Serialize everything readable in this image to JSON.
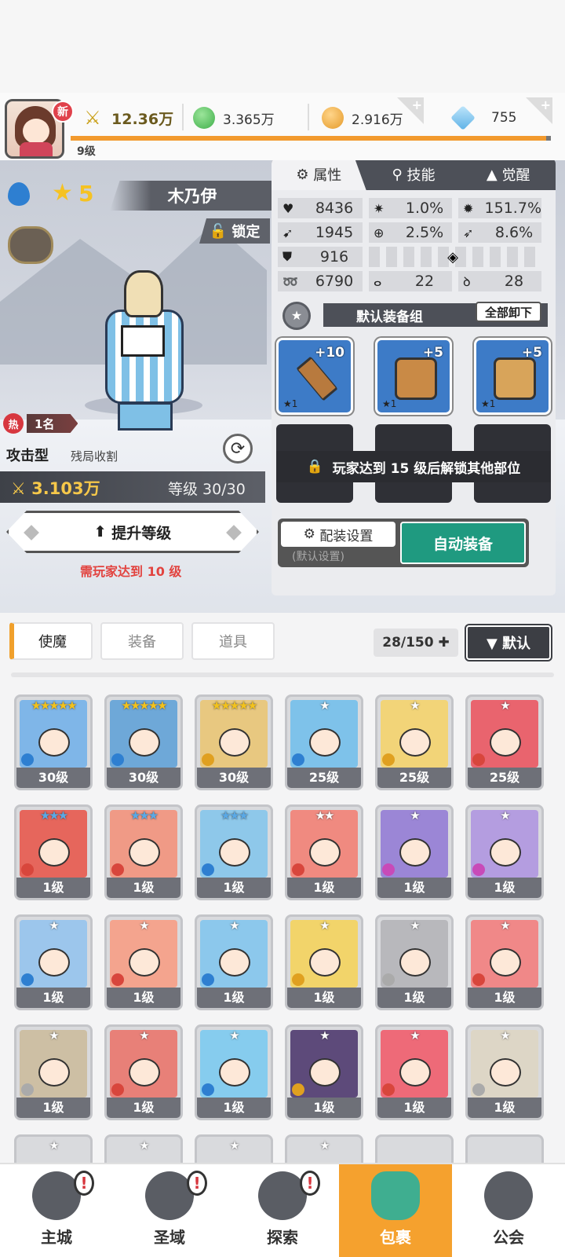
{
  "header": {
    "new_badge": "新",
    "power": "12.36万",
    "green_gem": "3.365万",
    "gold": "2.916万",
    "diamond": "755",
    "player_level": "9级"
  },
  "hero": {
    "star_count": "5",
    "name": "木乃伊",
    "lock_label": "锁定",
    "rank_badge": "热",
    "rank_text": "1名",
    "type": "攻击型",
    "subtype": "残局收割",
    "combat_power": "3.103万",
    "level_text": "等级 30/30",
    "upgrade_label": "提升等级",
    "requirement": "需玩家达到 10 级"
  },
  "panel": {
    "tabs": [
      "属性",
      "技能",
      "觉醒"
    ],
    "stats": {
      "hp": "8436",
      "crit": "1.0%",
      "crit_dmg": "151.7%",
      "atk": "1945",
      "accuracy": "2.5%",
      "dodge": "8.6%",
      "def": "916",
      "speed": "6790",
      "stat_a": "22",
      "stat_b": "28"
    },
    "group_name": "默认装备组",
    "unequip_all": "全部卸下",
    "equipment": [
      {
        "level": "+10",
        "stars": "★1"
      },
      {
        "level": "+5",
        "stars": "★1"
      },
      {
        "level": "+5",
        "stars": "★1"
      }
    ],
    "locked_message": "玩家达到 15 级后解锁其他部位",
    "config_label": "配装设置",
    "config_sub": "(默认设置)",
    "auto_equip": "自动装备"
  },
  "inventory": {
    "tabs": [
      "使魔",
      "装备",
      "道具"
    ],
    "count": "28/150",
    "sort_label": "▼ 默认",
    "cards": [
      {
        "stars": "★★★★★",
        "level": "30级",
        "color": "#7fb6e8"
      },
      {
        "stars": "★★★★★",
        "level": "30级",
        "color": "#6ea8d8"
      },
      {
        "stars": "★★★★★",
        "level": "30级",
        "color": "#e8c880"
      },
      {
        "stars": "★",
        "level": "25级",
        "color": "#7ec2ea"
      },
      {
        "stars": "★",
        "level": "25级",
        "color": "#f2d478"
      },
      {
        "stars": "★",
        "level": "25级",
        "color": "#e9646e"
      },
      {
        "stars": "★★★",
        "level": "1级",
        "color": "#e6665c"
      },
      {
        "stars": "★★★",
        "level": "1级",
        "color": "#f09a86"
      },
      {
        "stars": "★★★",
        "level": "1级",
        "color": "#8ec8ea"
      },
      {
        "stars": "★★",
        "level": "1级",
        "color": "#f08a80"
      },
      {
        "stars": "★",
        "level": "1级",
        "color": "#9b86d6"
      },
      {
        "stars": "★",
        "level": "1级",
        "color": "#b49de0"
      },
      {
        "stars": "★",
        "level": "1级",
        "color": "#9cc6ec"
      },
      {
        "stars": "★",
        "level": "1级",
        "color": "#f4a48e"
      },
      {
        "stars": "★",
        "level": "1级",
        "color": "#8cc8ec"
      },
      {
        "stars": "★",
        "level": "1级",
        "color": "#f2d46a"
      },
      {
        "stars": "★",
        "level": "1级",
        "color": "#b8b8bc"
      },
      {
        "stars": "★",
        "level": "1级",
        "color": "#f08888"
      },
      {
        "stars": "★",
        "level": "1级",
        "color": "#cdbfa4"
      },
      {
        "stars": "★",
        "level": "1级",
        "color": "#e88078"
      },
      {
        "stars": "★",
        "level": "1级",
        "color": "#86ccee"
      },
      {
        "stars": "★",
        "level": "1级",
        "color": "#5d4a7a"
      },
      {
        "stars": "★",
        "level": "1级",
        "color": "#ee6a78"
      },
      {
        "stars": "★",
        "level": "1级",
        "color": "#ddd6c6"
      },
      {
        "stars": "★",
        "level": "",
        "color": "#d9dadd"
      },
      {
        "stars": "★",
        "level": "",
        "color": "#d9dadd"
      },
      {
        "stars": "★",
        "level": "",
        "color": "#d9dadd"
      },
      {
        "stars": "★",
        "level": "",
        "color": "#d9dadd"
      },
      {
        "stars": "",
        "level": "",
        "color": "#d9dadd"
      },
      {
        "stars": "",
        "level": "",
        "color": "#d9dadd"
      }
    ]
  },
  "nav": [
    {
      "label": "主城",
      "alert": "!"
    },
    {
      "label": "圣域",
      "alert": "!"
    },
    {
      "label": "探索",
      "alert": "!"
    },
    {
      "label": "包裹",
      "alert": ""
    },
    {
      "label": "公会",
      "alert": ""
    }
  ]
}
